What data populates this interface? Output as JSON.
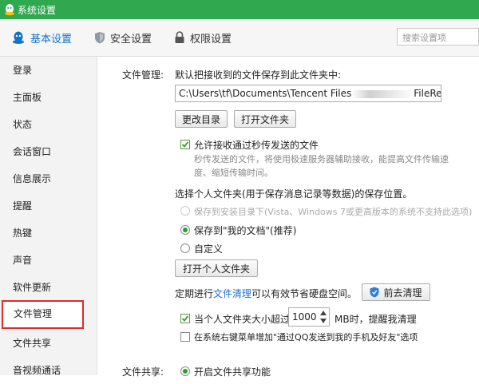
{
  "window": {
    "title": "系统设置"
  },
  "tabs": [
    {
      "label": "基本设置",
      "icon": "qq-penguin-icon",
      "active": true
    },
    {
      "label": "安全设置",
      "icon": "shield-icon",
      "active": false
    },
    {
      "label": "权限设置",
      "icon": "lock-icon",
      "active": false
    }
  ],
  "search": {
    "placeholder": "搜索设置项"
  },
  "sidebar": {
    "items": [
      {
        "label": "登录"
      },
      {
        "label": "主面板"
      },
      {
        "label": "状态"
      },
      {
        "label": "会话窗口"
      },
      {
        "label": "信息展示"
      },
      {
        "label": "提醒"
      },
      {
        "label": "热键"
      },
      {
        "label": "声音"
      },
      {
        "label": "软件更新"
      },
      {
        "label": "文件管理",
        "selected": true
      },
      {
        "label": "文件共享"
      },
      {
        "label": "音视频通话"
      }
    ]
  },
  "file_management": {
    "section_label": "文件管理:",
    "save_hint": "默认把接收到的文件保存到此文件夹中:",
    "path_prefix": "C:\\Users\\tf\\Documents\\Tencent Files",
    "path_suffix": "FileRecv\\",
    "change_dir_button": "更改目录",
    "open_folder_button": "打开文件夹",
    "allow_transfer": {
      "label": "允许接收通过秒传发送的文件",
      "checked": true
    },
    "transfer_desc": "秒传发送的文件，将使用极速服务器辅助接收，能提高文件传输速度、缩短传输时间。",
    "personal_folder_label": "选择个人文件夹(用于保存消息记录等数据)的保存位置。",
    "location_options": [
      {
        "label": "保存到安装目录下(Vista、Windows 7或更高版本的系统不支持此选项)",
        "selected": false,
        "disabled": true
      },
      {
        "label": "保存到\"我的文档\"(推荐)",
        "selected": true,
        "disabled": false
      },
      {
        "label": "自定义",
        "selected": false,
        "disabled": false
      }
    ],
    "open_personal_button": "打开个人文件夹",
    "cleanup_prefix": "定期进行",
    "cleanup_link": "文件清理",
    "cleanup_suffix": "可以有效节省硬盘空间。",
    "go_clean_button": "前去清理",
    "size_alert": {
      "label_prefix": "当个人文件夹大小超过",
      "value": "1000",
      "label_suffix": "MB时，提醒我清理",
      "checked": true
    },
    "context_menu": {
      "label": "在系统右键菜单增加\"通过QQ发送到我的手机及好友\"选项",
      "checked": false
    }
  },
  "file_sharing": {
    "section_label": "文件共享:",
    "enable": {
      "label": "开启文件共享功能",
      "selected": true
    }
  },
  "colors": {
    "titlebar": "#2fa84f",
    "active_tab": "#1672c9",
    "selected_outline": "#e02a2a",
    "link": "#1a6fd0"
  }
}
